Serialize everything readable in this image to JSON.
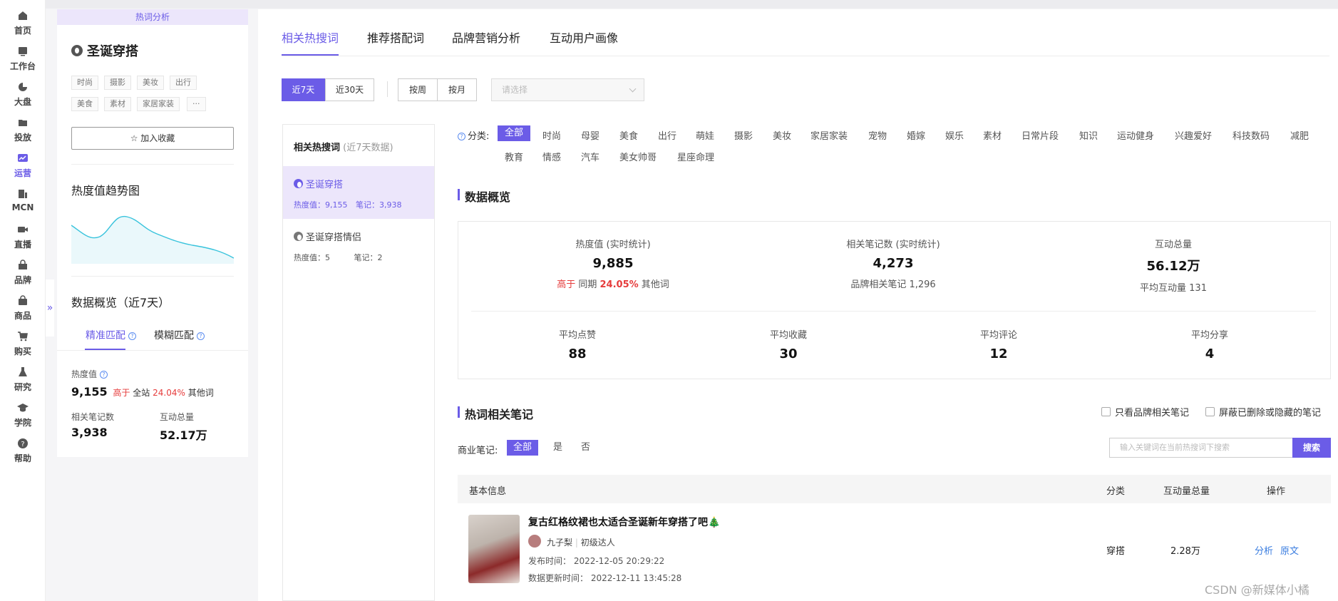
{
  "nav": {
    "items": [
      {
        "label": "首页",
        "icon": "home-icon"
      },
      {
        "label": "工作台",
        "icon": "dashboard-icon"
      },
      {
        "label": "大盘",
        "icon": "pie-chart-icon"
      },
      {
        "label": "投放",
        "icon": "folder-icon"
      },
      {
        "label": "运营",
        "icon": "trend-chart-icon",
        "active": true
      },
      {
        "label": "MCN",
        "icon": "building-icon"
      },
      {
        "label": "直播",
        "icon": "video-icon"
      },
      {
        "label": "品牌",
        "icon": "store-icon"
      },
      {
        "label": "商品",
        "icon": "bag-icon"
      },
      {
        "label": "购买",
        "icon": "cart-icon"
      },
      {
        "label": "研究",
        "icon": "flask-icon"
      },
      {
        "label": "学院",
        "icon": "graduation-cap-icon"
      },
      {
        "label": "帮助",
        "icon": "help-icon"
      }
    ],
    "collapse_glyph": "»"
  },
  "keyword_panel": {
    "badge": "热词分析",
    "title": "圣诞穿搭",
    "tags": [
      "时尚",
      "摄影",
      "美妆",
      "出行",
      "美食",
      "素材",
      "家居家装",
      "···"
    ],
    "favorite_label": "加入收藏",
    "trend_title": "热度值趋势图",
    "overview_title": "数据概览（近7天）",
    "match_tabs": [
      "精准匹配",
      "模糊匹配"
    ],
    "heat_label": "热度值",
    "heat_value": "9,155",
    "heat_compare_prefix": "高于",
    "heat_compare_scope": "全站",
    "heat_compare_pct": "24.04%",
    "heat_compare_suffix": "其他词",
    "notes_label": "相关笔记数",
    "notes_value": "3,938",
    "interact_label": "互动总量",
    "interact_value": "52.17万"
  },
  "tabs": [
    "相关热搜词",
    "推荐搭配词",
    "品牌营销分析",
    "互动用户画像"
  ],
  "filters": {
    "range": [
      "近7天",
      "近30天"
    ],
    "period": [
      "按周",
      "按月"
    ],
    "select_placeholder": "请选择"
  },
  "related": {
    "title": "相关热搜词",
    "subtitle": "(近7天数据)",
    "items": [
      {
        "name": "圣诞穿搭",
        "heat_label": "热度值：",
        "heat": "9,155",
        "notes_label": "笔记：",
        "notes": "3,938"
      },
      {
        "name": "圣诞穿搭情侣",
        "heat_label": "热度值：",
        "heat": "5",
        "notes_label": "笔记：",
        "notes": "2"
      }
    ]
  },
  "categories": {
    "label": "分类:",
    "items": [
      "全部",
      "时尚",
      "母婴",
      "美食",
      "出行",
      "萌娃",
      "摄影",
      "美妆",
      "家居家装",
      "宠物",
      "婚嫁",
      "娱乐",
      "素材",
      "日常片段",
      "知识",
      "运动健身",
      "兴趣爱好",
      "科技数码",
      "减肥",
      "教育",
      "情感",
      "汽车",
      "美女帅哥",
      "星座命理"
    ]
  },
  "overview": {
    "title": "数据概览",
    "heat_label": "热度值 (实时统计)",
    "heat_value": "9,885",
    "heat_sub_prefix": "高于",
    "heat_sub_mid": "同期",
    "heat_sub_pct": "24.05%",
    "heat_sub_suffix": "其他词",
    "notes_label": "相关笔记数 (实时统计)",
    "notes_value": "4,273",
    "notes_sub": "品牌相关笔记 1,296",
    "interact_label": "互动总量",
    "interact_value": "56.12万",
    "interact_sub": "平均互动量 131",
    "avg": [
      {
        "label": "平均点赞",
        "value": "88"
      },
      {
        "label": "平均收藏",
        "value": "30"
      },
      {
        "label": "平均评论",
        "value": "12"
      },
      {
        "label": "平均分享",
        "value": "4"
      }
    ]
  },
  "notes": {
    "title": "热词相关笔记",
    "check_brand": "只看品牌相关笔记",
    "check_hidden": "屏蔽已删除或隐藏的笔记",
    "commercial_label": "商业笔记:",
    "commercial_opts": [
      "全部",
      "是",
      "否"
    ],
    "search_placeholder": "输入关键词在当前热搜词下搜索",
    "search_btn": "搜索",
    "columns": [
      "基本信息",
      "分类",
      "互动量总量",
      "操作"
    ],
    "rows": [
      {
        "title": "复古红格纹裙也太适合圣诞新年穿搭了吧🎄",
        "author": "九子梨",
        "level": "初级达人",
        "publish": "发布时间：  2022-12-05 20:29:22",
        "updated": "数据更新时间：  2022-12-11 13:45:28",
        "category": "穿搭",
        "interact": "2.28万",
        "action_analyze": "分析",
        "action_origin": "原文"
      }
    ]
  },
  "watermark": "CSDN @新媒体小橘",
  "colors": {
    "accent": "#6b5ce7",
    "danger": "#e63c3c",
    "link": "#3a7de0"
  }
}
